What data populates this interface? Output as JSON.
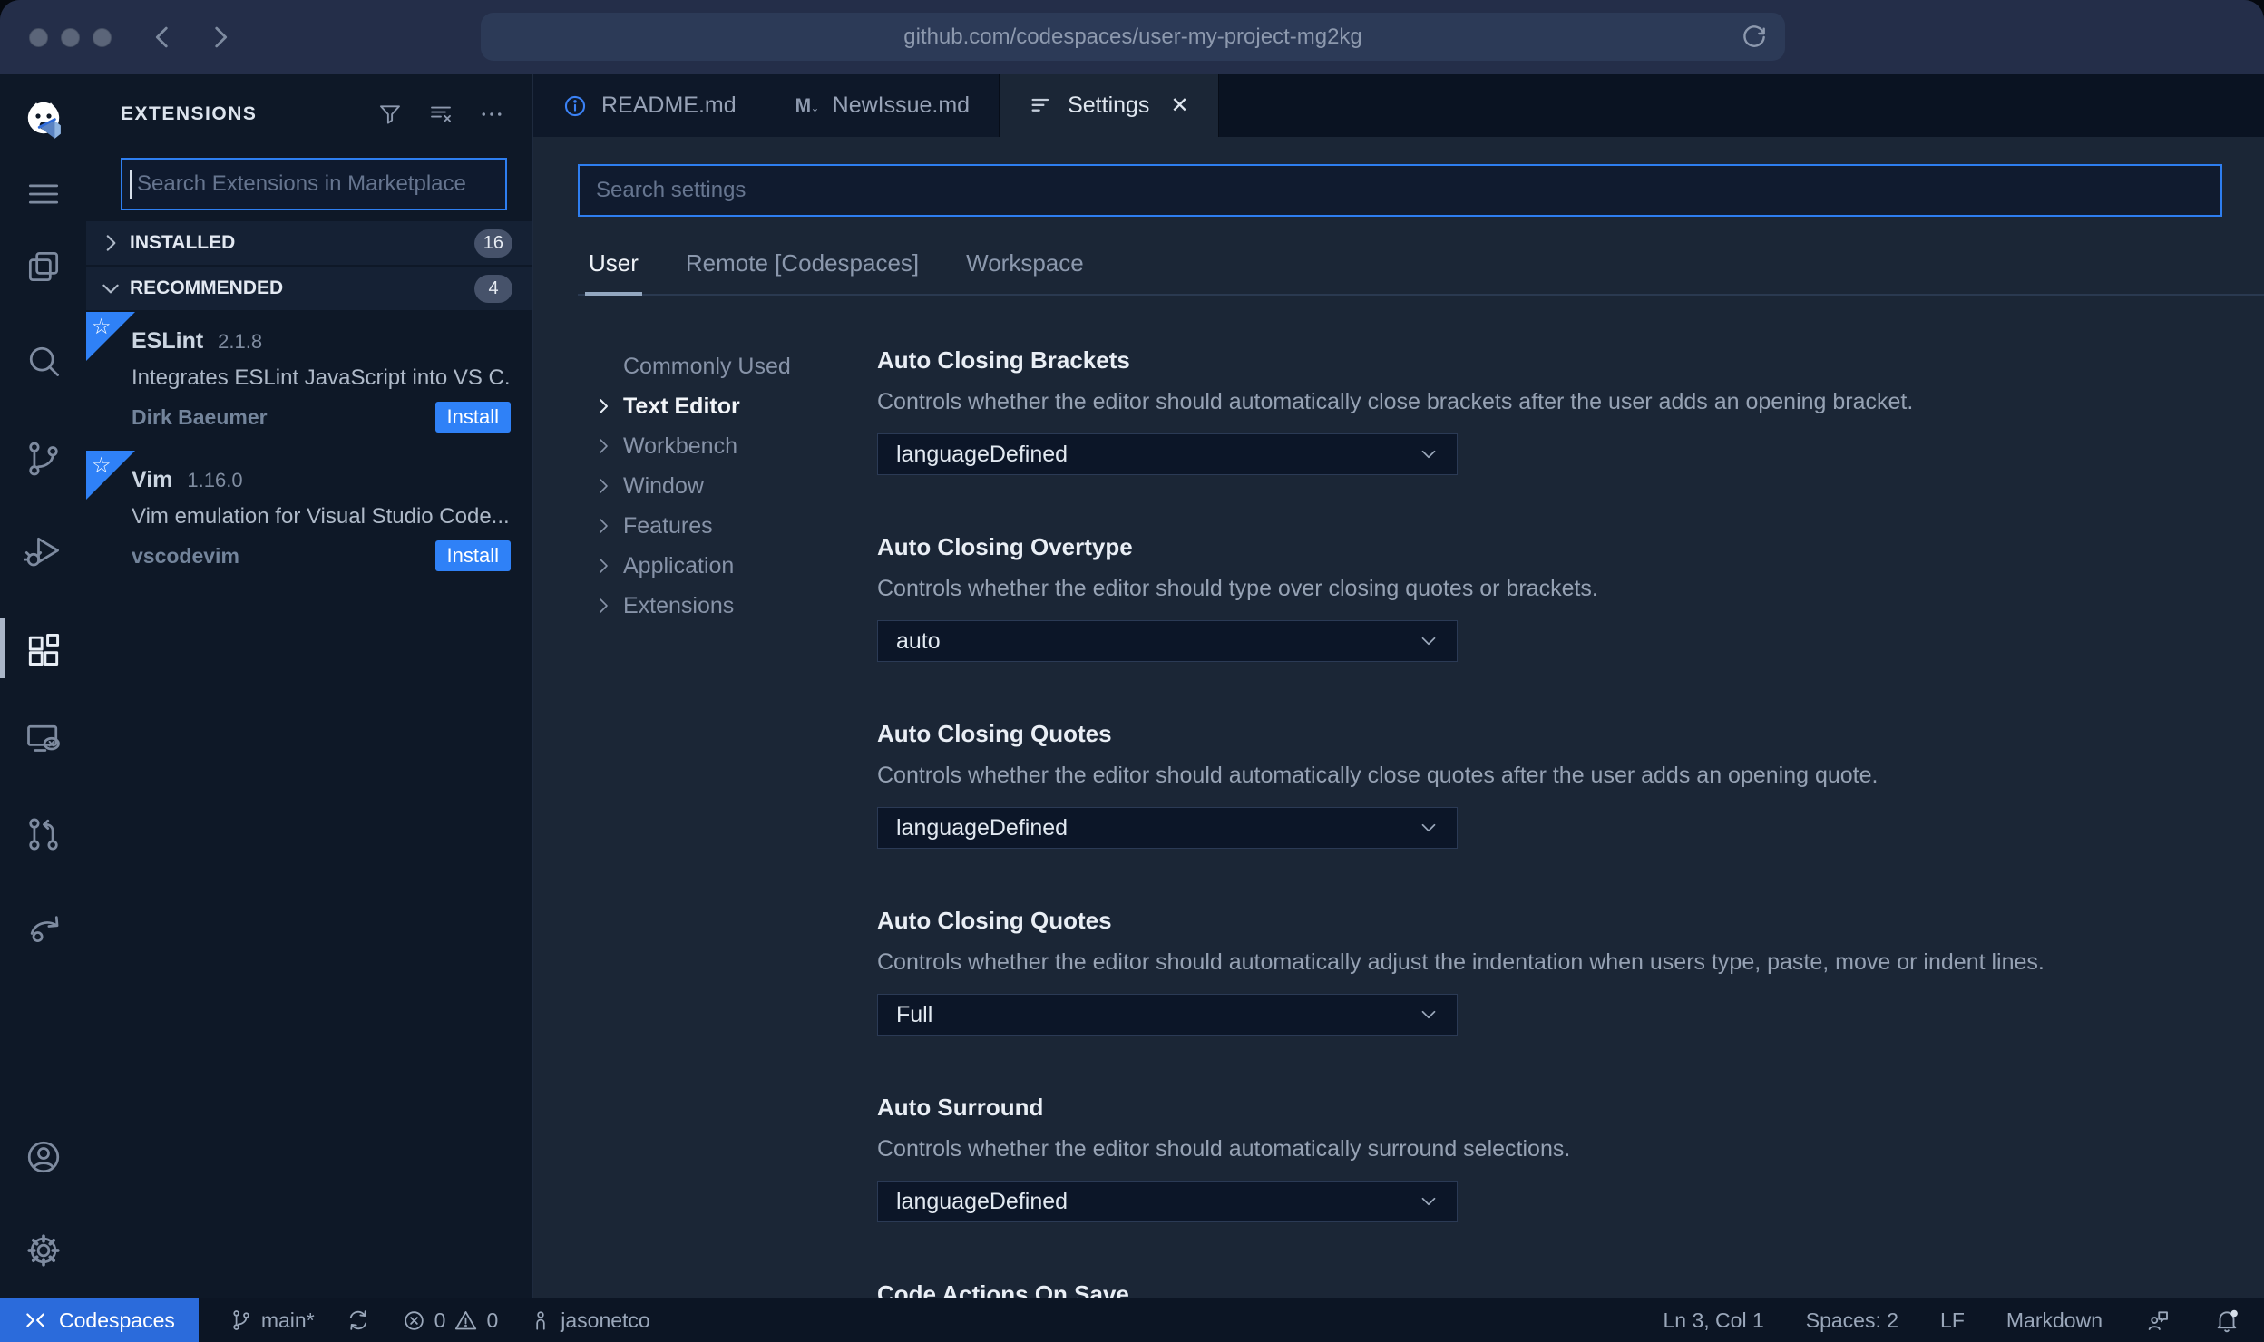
{
  "browser": {
    "url": "github.com/codespaces/user-my-project-mg2kg"
  },
  "sidebar": {
    "title": "EXTENSIONS",
    "search_placeholder": "Search Extensions in Marketplace",
    "sections": [
      {
        "label": "INSTALLED",
        "count": "16"
      },
      {
        "label": "RECOMMENDED",
        "count": "4"
      }
    ],
    "extensions": [
      {
        "name": "ESLint",
        "version": "2.1.8",
        "description": "Integrates ESLint JavaScript into VS C...",
        "author": "Dirk Baeumer",
        "action": "Install"
      },
      {
        "name": "Vim",
        "version": "1.16.0",
        "description": "Vim emulation for Visual Studio Code...",
        "author": "vscodevim",
        "action": "Install"
      }
    ]
  },
  "tabs": [
    {
      "label": "README.md"
    },
    {
      "label": "NewIssue.md",
      "icon_text": "M↓"
    },
    {
      "label": "Settings",
      "close": "✕"
    }
  ],
  "settings_page": {
    "search_placeholder": "Search settings",
    "scopes": [
      {
        "label": "User"
      },
      {
        "label": "Remote [Codespaces]"
      },
      {
        "label": "Workspace"
      }
    ],
    "toc": [
      {
        "label": "Commonly Used"
      },
      {
        "label": "Text Editor"
      },
      {
        "label": "Workbench"
      },
      {
        "label": "Window"
      },
      {
        "label": "Features"
      },
      {
        "label": "Application"
      },
      {
        "label": "Extensions"
      }
    ],
    "items": [
      {
        "title": "Auto Closing Brackets",
        "description": "Controls whether the editor should automatically close brackets after the user adds an opening bracket.",
        "value": "languageDefined"
      },
      {
        "title": "Auto Closing Overtype",
        "description": "Controls whether the editor should type over closing quotes or brackets.",
        "value": "auto"
      },
      {
        "title": "Auto Closing Quotes",
        "description": "Controls whether the editor should automatically close quotes after the user adds an opening quote.",
        "value": "languageDefined"
      },
      {
        "title": "Auto Closing Quotes",
        "description": "Controls whether the editor should automatically adjust the indentation when users type, paste, move or indent lines.",
        "value": "Full"
      },
      {
        "title": "Auto Surround",
        "description": "Controls whether the editor should automatically surround selections.",
        "value": "languageDefined"
      },
      {
        "title": "Code Actions On Save"
      }
    ]
  },
  "status_bar": {
    "codespaces": "Codespaces",
    "branch": "main*",
    "errors": "0",
    "warnings": "0",
    "user": "jasonetco",
    "line_col": "Ln 3, Col 1",
    "spaces": "Spaces: 2",
    "eol": "LF",
    "language": "Markdown"
  },
  "colors": {
    "accent_blue": "#2e7ef0",
    "install_blue": "#2f81f7",
    "codespaces_statusbar_blue": "#2b6bdb",
    "editor_bg": "#1b2636",
    "sidebar_bg": "#0e1827"
  }
}
